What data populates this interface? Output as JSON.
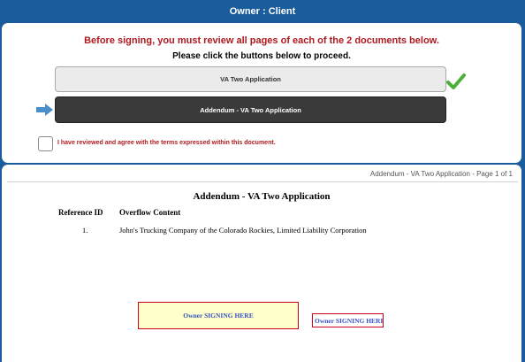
{
  "window": {
    "title": "Owner : Client"
  },
  "notice": {
    "warning": "Before signing, you must review all pages of each of the 2 documents below.",
    "instruction": "Please click the buttons below to proceed."
  },
  "documents": [
    {
      "label": "VA Two Application",
      "status": "reviewed"
    },
    {
      "label": "Addendum - VA Two Application",
      "status": "current"
    }
  ],
  "agreement": {
    "label": "I have reviewed and agree with the terms expressed within this document.",
    "checked": false
  },
  "viewer": {
    "page_indicator": "Addendum - VA Two Application - Page 1 of 1",
    "doc_title": "Addendum - VA Two Application",
    "table": {
      "headers": [
        "Reference ID",
        "Overflow Content"
      ],
      "rows": [
        [
          "1.",
          "John's Trucking Company of the Colorado Rockies, Limited Liability Corporation"
        ]
      ]
    },
    "sign_fields": [
      {
        "label": "Owner SIGNING HERE"
      },
      {
        "label": "Owner SIGNING HERE"
      }
    ]
  },
  "icons": {
    "reviewed": "check-icon",
    "current": "arrow-right-icon"
  },
  "colors": {
    "frame": "#1b5c9c",
    "warning_text": "#b0191e",
    "checkmark": "#4caf3a",
    "arrow": "#4a8fc9",
    "sign_field_border": "#d0021b",
    "sign_field_fill": "#ffffcc",
    "sign_text": "#3a53c6"
  }
}
